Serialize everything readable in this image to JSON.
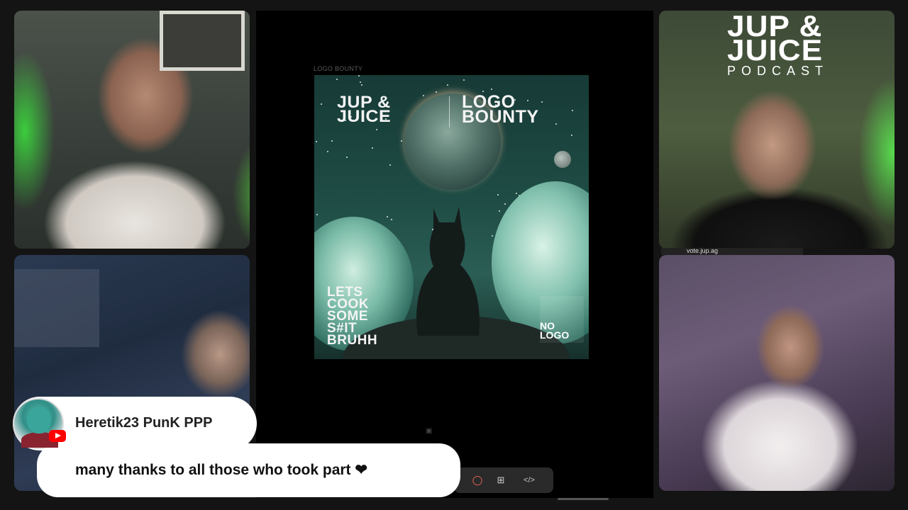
{
  "share": {
    "caption": "LOGO BOUNTY",
    "poster": {
      "title_left": "JUP &\nJUICE",
      "title_right": "LOGO\nBOUNTY",
      "tagline": "LETS\nCOOK\nSOME\nS#IT\nBRUHH",
      "nologo": "NO\nLOGO"
    }
  },
  "brand": {
    "name": "JUP &\nJUICE",
    "sub": "PODCAST"
  },
  "url_label": "vote.jup.ag",
  "chat": {
    "author": "Heretik23 PunK PPP",
    "message": "many thanks to all those who took part ❤"
  },
  "toolbar": {
    "record_icon": "record-icon",
    "apps_icon": "apps-icon",
    "embed_icon": "code-icon"
  },
  "colors": {
    "background": "#141414",
    "youtube_red": "#ff0000",
    "chat_bubble": "#ffffff"
  }
}
